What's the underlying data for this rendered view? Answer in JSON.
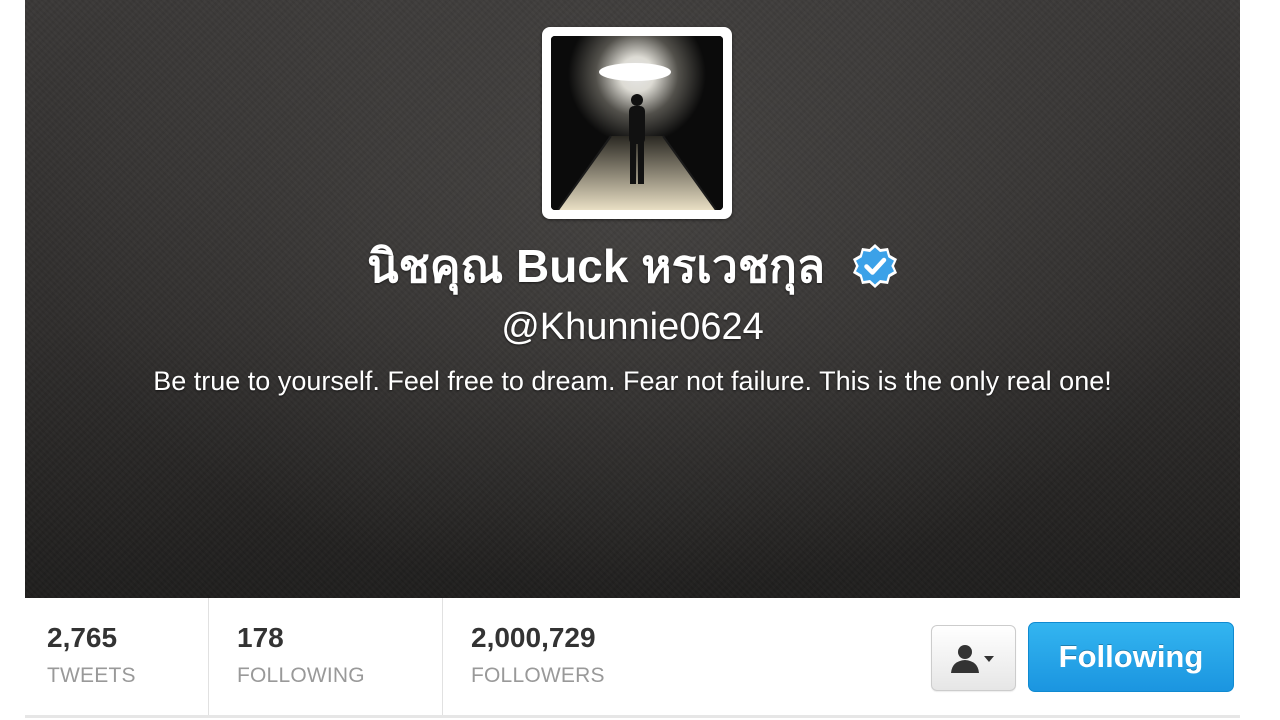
{
  "profile": {
    "display_name": "นิชคุณ Buck หรเวชกุล",
    "screen_name": "@Khunnie0624",
    "bio": "Be true to yourself. Feel free to dream. Fear not failure. This is the only real one!",
    "verified": true
  },
  "stats": [
    {
      "count": "2,765",
      "label": "TWEETS"
    },
    {
      "count": "178",
      "label": "FOLLOWING"
    },
    {
      "count": "2,000,729",
      "label": "FOLLOWERS"
    }
  ],
  "actions": {
    "user_menu_icon": "user-dropdown-icon",
    "follow_label": "Following"
  },
  "colors": {
    "verified_blue": "#3ba1e8",
    "follow_button": "#1b95e0",
    "stat_count": "#333333",
    "stat_label": "#999999"
  }
}
